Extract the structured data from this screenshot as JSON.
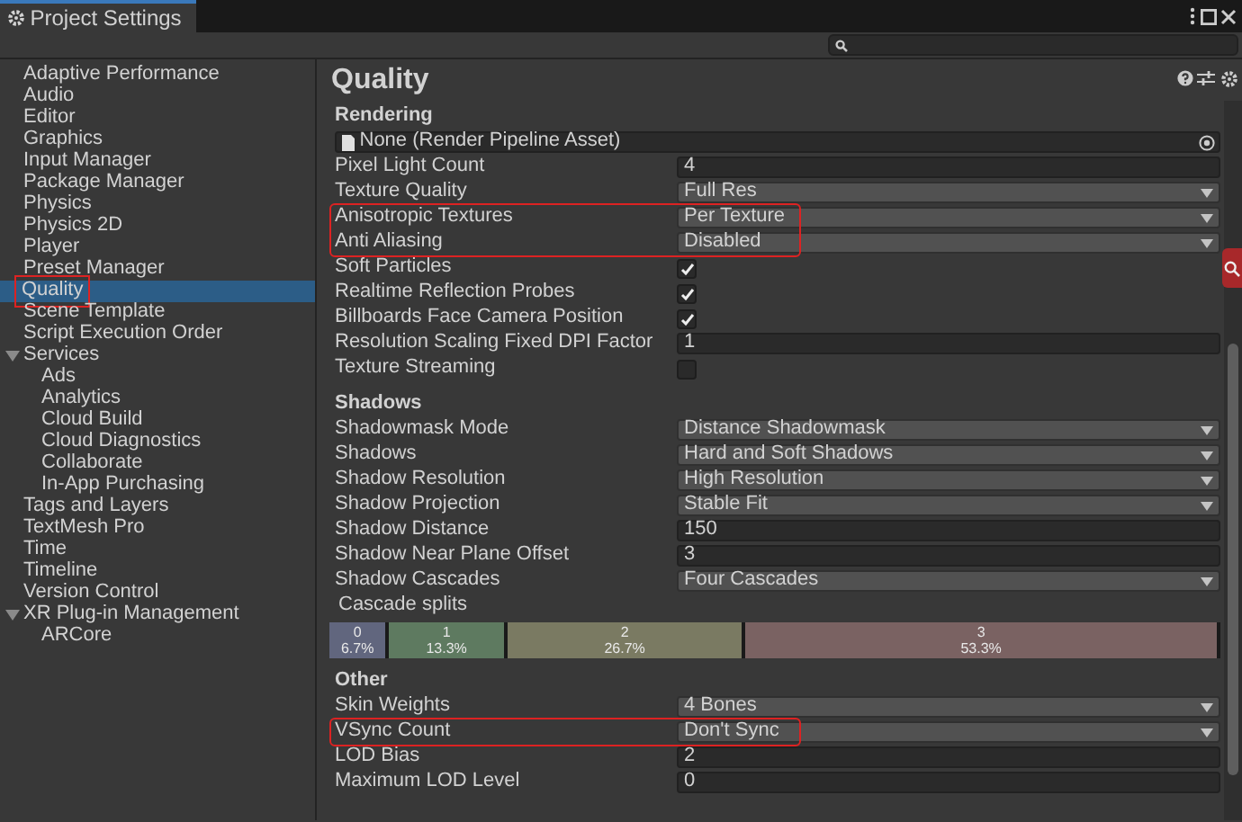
{
  "window": {
    "title": "Project Settings"
  },
  "sidebar": {
    "items": [
      {
        "label": "Adaptive Performance",
        "selected": false,
        "highlighted": false
      },
      {
        "label": "Audio",
        "selected": false,
        "highlighted": false
      },
      {
        "label": "Editor",
        "selected": false,
        "highlighted": false
      },
      {
        "label": "Graphics",
        "selected": false,
        "highlighted": false
      },
      {
        "label": "Input Manager",
        "selected": false,
        "highlighted": false
      },
      {
        "label": "Package Manager",
        "selected": false,
        "highlighted": false
      },
      {
        "label": "Physics",
        "selected": false,
        "highlighted": false
      },
      {
        "label": "Physics 2D",
        "selected": false,
        "highlighted": false
      },
      {
        "label": "Player",
        "selected": false,
        "highlighted": false
      },
      {
        "label": "Preset Manager",
        "selected": false,
        "highlighted": false
      },
      {
        "label": "Quality",
        "selected": true,
        "highlighted": true
      },
      {
        "label": "Scene Template",
        "selected": false,
        "highlighted": false
      },
      {
        "label": "Script Execution Order",
        "selected": false,
        "highlighted": false
      },
      {
        "label": "Services",
        "selected": false,
        "highlighted": false,
        "expanded": true,
        "children": [
          {
            "label": "Ads",
            "selected": false,
            "highlighted": false
          },
          {
            "label": "Analytics",
            "selected": false,
            "highlighted": false
          },
          {
            "label": "Cloud Build",
            "selected": false,
            "highlighted": false
          },
          {
            "label": "Cloud Diagnostics",
            "selected": false,
            "highlighted": false
          },
          {
            "label": "Collaborate",
            "selected": false,
            "highlighted": false
          },
          {
            "label": "In-App Purchasing",
            "selected": false,
            "highlighted": false
          }
        ]
      },
      {
        "label": "Tags and Layers",
        "selected": false,
        "highlighted": false
      },
      {
        "label": "TextMesh Pro",
        "selected": false,
        "highlighted": false
      },
      {
        "label": "Time",
        "selected": false,
        "highlighted": false
      },
      {
        "label": "Timeline",
        "selected": false,
        "highlighted": false
      },
      {
        "label": "Version Control",
        "selected": false,
        "highlighted": false
      },
      {
        "label": "XR Plug-in Management",
        "selected": false,
        "highlighted": false,
        "expanded": true,
        "children": [
          {
            "label": "ARCore",
            "selected": false,
            "highlighted": false
          }
        ]
      }
    ]
  },
  "panel": {
    "title": "Quality",
    "sections": [
      {
        "title": "Rendering",
        "rows": [
          {
            "kind": "object",
            "value": "None (Render Pipeline Asset)",
            "highlighted": false
          },
          {
            "kind": "number",
            "label": "Pixel Light Count",
            "value": "4",
            "highlighted": false
          },
          {
            "kind": "dropdown",
            "label": "Texture Quality",
            "value": "Full Res",
            "highlighted": false
          },
          {
            "kind": "dropdown",
            "label": "Anisotropic Textures",
            "value": "Per Texture",
            "highlighted": true
          },
          {
            "kind": "dropdown",
            "label": "Anti Aliasing",
            "value": "Disabled",
            "highlighted": true
          },
          {
            "kind": "checkbox",
            "label": "Soft Particles",
            "checked": true,
            "highlighted": false
          },
          {
            "kind": "checkbox",
            "label": "Realtime Reflection Probes",
            "checked": true,
            "highlighted": false
          },
          {
            "kind": "checkbox",
            "label": "Billboards Face Camera Position",
            "checked": true,
            "highlighted": false
          },
          {
            "kind": "number",
            "label": "Resolution Scaling Fixed DPI Factor",
            "value": "1",
            "highlighted": false
          },
          {
            "kind": "checkbox",
            "label": "Texture Streaming",
            "checked": false,
            "highlighted": false
          }
        ]
      },
      {
        "title": "Shadows",
        "rows": [
          {
            "kind": "dropdown",
            "label": "Shadowmask Mode",
            "value": "Distance Shadowmask",
            "highlighted": false
          },
          {
            "kind": "dropdown",
            "label": "Shadows",
            "value": "Hard and Soft Shadows",
            "highlighted": false
          },
          {
            "kind": "dropdown",
            "label": "Shadow Resolution",
            "value": "High Resolution",
            "highlighted": false
          },
          {
            "kind": "dropdown",
            "label": "Shadow Projection",
            "value": "Stable Fit",
            "highlighted": false
          },
          {
            "kind": "number",
            "label": "Shadow Distance",
            "value": "150",
            "highlighted": false
          },
          {
            "kind": "number",
            "label": "Shadow Near Plane Offset",
            "value": "3",
            "highlighted": false
          },
          {
            "kind": "dropdown",
            "label": "Shadow Cascades",
            "value": "Four Cascades",
            "highlighted": false
          }
        ],
        "cascade_splits": {
          "label": "Cascade splits",
          "segments": [
            {
              "index": "0",
              "percent": "6.7%",
              "color": "#61667e"
            },
            {
              "index": "1",
              "percent": "13.3%",
              "color": "#5e7a60"
            },
            {
              "index": "2",
              "percent": "26.7%",
              "color": "#7a7a62"
            },
            {
              "index": "3",
              "percent": "53.3%",
              "color": "#7a6262"
            }
          ]
        }
      },
      {
        "title": "Other",
        "rows": [
          {
            "kind": "dropdown",
            "label": "Skin Weights",
            "value": "4 Bones",
            "highlighted": false
          },
          {
            "kind": "dropdown",
            "label": "VSync Count",
            "value": "Don't Sync",
            "highlighted": true
          },
          {
            "kind": "number",
            "label": "LOD Bias",
            "value": "2",
            "highlighted": false
          },
          {
            "kind": "number",
            "label": "Maximum LOD Level",
            "value": "0",
            "highlighted": false
          }
        ]
      }
    ]
  }
}
